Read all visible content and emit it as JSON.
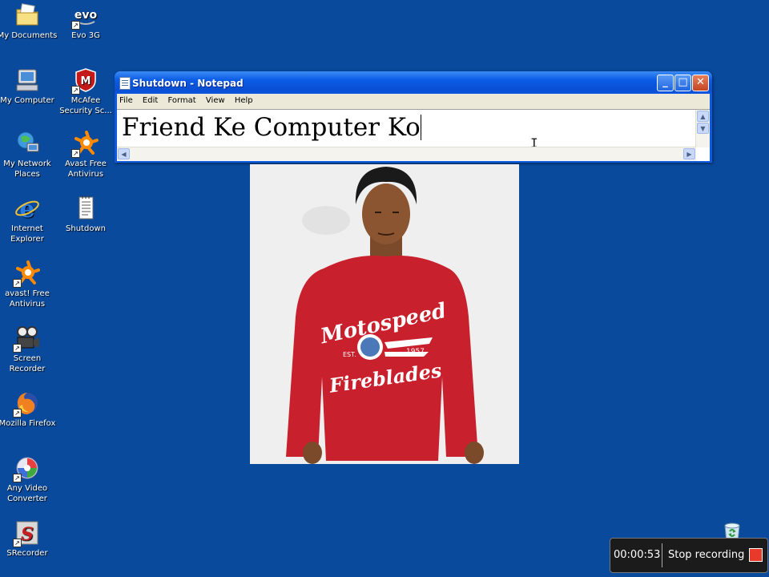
{
  "desktop": {
    "icons": [
      {
        "label": "My Documents",
        "icon": "my-documents-icon"
      },
      {
        "label": "Evo 3G",
        "icon": "evo-3g-icon"
      },
      {
        "label": "My Computer",
        "icon": "my-computer-icon"
      },
      {
        "label": "McAfee Security Sc...",
        "icon": "mcafee-icon"
      },
      {
        "label": "My Network Places",
        "icon": "network-places-icon"
      },
      {
        "label": "Avast Free Antivirus",
        "icon": "avast-icon"
      },
      {
        "label": "Internet Explorer",
        "icon": "internet-explorer-icon"
      },
      {
        "label": "Shutdown",
        "icon": "text-file-icon"
      },
      {
        "label": "avast! Free Antivirus",
        "icon": "avast-icon"
      },
      {
        "label": "Screen Recorder",
        "icon": "screen-recorder-icon"
      },
      {
        "label": "Mozilla Firefox",
        "icon": "firefox-icon"
      },
      {
        "label": "Any Video Converter",
        "icon": "video-converter-icon"
      },
      {
        "label": "SRecorder",
        "icon": "srecorder-icon"
      }
    ],
    "evo_logo_text": "evo",
    "mcafee_logo_text": "M",
    "srecorder_logo_text": "S",
    "background_color": "#0a4a9c"
  },
  "notepad": {
    "title": "Shutdown - Notepad",
    "menu": [
      "File",
      "Edit",
      "Format",
      "View",
      "Help"
    ],
    "content": "Friend Ke Computer Ko",
    "buttons": {
      "minimize": "_",
      "maximize": "□",
      "close": "✕"
    }
  },
  "photo": {
    "description_icon": "person-photo",
    "shirt_text_top": "Motospeed",
    "shirt_text_bottom": "Fireblades",
    "shirt_est": "EST.",
    "shirt_year": "1957",
    "shirt_color": "#c8202c"
  },
  "recorder": {
    "timer": "00:00:53",
    "stop_label": "Stop recording"
  }
}
